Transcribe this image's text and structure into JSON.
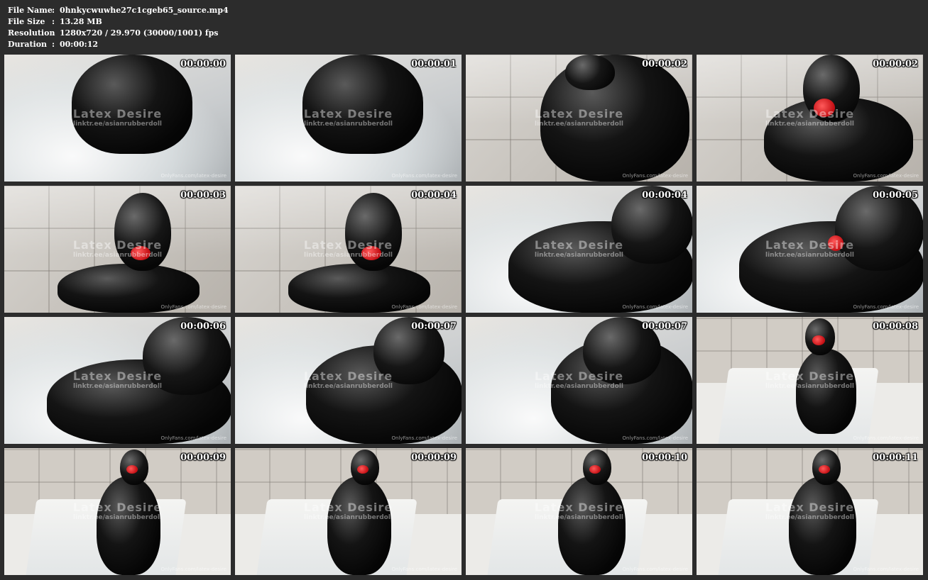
{
  "info": {
    "file_name_label": "File Name",
    "file_name": "0hnkycwuwhe27c1cgeb65_source.mp4",
    "file_size_label": "File Size",
    "file_size": "13.28 MB",
    "resolution_label": "Resolution",
    "resolution": "1280x720 / 29.970 (30000/1001) fps",
    "duration_label": "Duration",
    "duration": "00:00:12",
    "separator": ":"
  },
  "watermark": {
    "title": "Latex Desire",
    "link": "linktr.ee/asianrubberdoll",
    "onlyfans": "OnlyFans.com/latex-desire"
  },
  "thumbnails": [
    {
      "time": "00:00:00"
    },
    {
      "time": "00:00:01"
    },
    {
      "time": "00:00:02"
    },
    {
      "time": "00:00:02"
    },
    {
      "time": "00:00:03"
    },
    {
      "time": "00:00:04"
    },
    {
      "time": "00:00:04"
    },
    {
      "time": "00:00:05"
    },
    {
      "time": "00:00:06"
    },
    {
      "time": "00:00:07"
    },
    {
      "time": "00:00:07"
    },
    {
      "time": "00:00:08"
    },
    {
      "time": "00:00:09"
    },
    {
      "time": "00:00:09"
    },
    {
      "time": "00:00:10"
    },
    {
      "time": "00:00:11"
    }
  ]
}
